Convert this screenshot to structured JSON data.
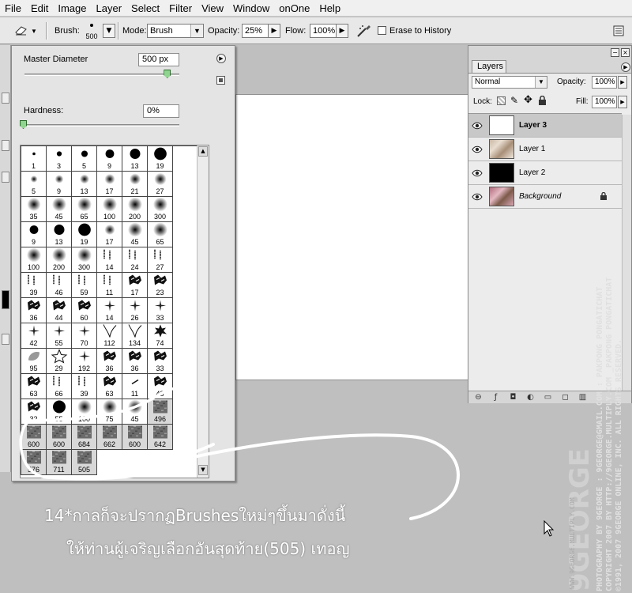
{
  "menu": [
    "File",
    "Edit",
    "Image",
    "Layer",
    "Select",
    "Filter",
    "View",
    "Window",
    "onOne",
    "Help"
  ],
  "options_bar": {
    "brush_label": "Brush:",
    "brush_size": "500",
    "mode_label": "Mode:",
    "mode_value": "Brush",
    "opacity_label": "Opacity:",
    "opacity_value": "25%",
    "flow_label": "Flow:",
    "flow_value": "100%",
    "erase_to_history_label": "Erase to History",
    "erase_to_history_checked": false
  },
  "brush_picker": {
    "master_diameter_label": "Master Diameter",
    "master_diameter_value": "500 px",
    "master_diameter_fraction": 0.92,
    "hardness_label": "Hardness:",
    "hardness_value": "0%",
    "hardness_fraction": 0.0,
    "brushes": [
      {
        "size": "1",
        "kind": "hard"
      },
      {
        "size": "3",
        "kind": "hard"
      },
      {
        "size": "5",
        "kind": "hard"
      },
      {
        "size": "9",
        "kind": "hard"
      },
      {
        "size": "13",
        "kind": "hard"
      },
      {
        "size": "19",
        "kind": "hard"
      },
      {
        "size": "5",
        "kind": "soft"
      },
      {
        "size": "9",
        "kind": "soft"
      },
      {
        "size": "13",
        "kind": "soft"
      },
      {
        "size": "17",
        "kind": "soft"
      },
      {
        "size": "21",
        "kind": "soft"
      },
      {
        "size": "27",
        "kind": "soft"
      },
      {
        "size": "35",
        "kind": "soft"
      },
      {
        "size": "45",
        "kind": "soft"
      },
      {
        "size": "65",
        "kind": "soft"
      },
      {
        "size": "100",
        "kind": "soft"
      },
      {
        "size": "200",
        "kind": "soft"
      },
      {
        "size": "300",
        "kind": "soft"
      },
      {
        "size": "9",
        "kind": "hard"
      },
      {
        "size": "13",
        "kind": "hard"
      },
      {
        "size": "19",
        "kind": "hard"
      },
      {
        "size": "17",
        "kind": "soft"
      },
      {
        "size": "45",
        "kind": "soft"
      },
      {
        "size": "65",
        "kind": "soft"
      },
      {
        "size": "100",
        "kind": "soft"
      },
      {
        "size": "200",
        "kind": "soft"
      },
      {
        "size": "300",
        "kind": "soft"
      },
      {
        "size": "14",
        "kind": "splatter"
      },
      {
        "size": "24",
        "kind": "splatter"
      },
      {
        "size": "27",
        "kind": "splatter"
      },
      {
        "size": "39",
        "kind": "splatter"
      },
      {
        "size": "46",
        "kind": "splatter"
      },
      {
        "size": "59",
        "kind": "splatter"
      },
      {
        "size": "11",
        "kind": "splatter"
      },
      {
        "size": "17",
        "kind": "chalk"
      },
      {
        "size": "23",
        "kind": "chalk"
      },
      {
        "size": "36",
        "kind": "chalk"
      },
      {
        "size": "44",
        "kind": "chalk"
      },
      {
        "size": "60",
        "kind": "chalk"
      },
      {
        "size": "14",
        "kind": "star"
      },
      {
        "size": "26",
        "kind": "star"
      },
      {
        "size": "33",
        "kind": "star"
      },
      {
        "size": "42",
        "kind": "star"
      },
      {
        "size": "55",
        "kind": "star"
      },
      {
        "size": "70",
        "kind": "star"
      },
      {
        "size": "112",
        "kind": "grass"
      },
      {
        "size": "134",
        "kind": "grass"
      },
      {
        "size": "74",
        "kind": "leaf"
      },
      {
        "size": "95",
        "kind": "leaf-soft"
      },
      {
        "size": "29",
        "kind": "outline-star"
      },
      {
        "size": "192",
        "kind": "star"
      },
      {
        "size": "36",
        "kind": "chalk"
      },
      {
        "size": "36",
        "kind": "chalk"
      },
      {
        "size": "33",
        "kind": "chalk"
      },
      {
        "size": "63",
        "kind": "chalk"
      },
      {
        "size": "66",
        "kind": "splatter"
      },
      {
        "size": "39",
        "kind": "splatter"
      },
      {
        "size": "63",
        "kind": "chalk"
      },
      {
        "size": "11",
        "kind": "stroke"
      },
      {
        "size": "48",
        "kind": "chalk"
      },
      {
        "size": "32",
        "kind": "chalk"
      },
      {
        "size": "55",
        "kind": "hard"
      },
      {
        "size": "100",
        "kind": "soft"
      },
      {
        "size": "75",
        "kind": "soft"
      },
      {
        "size": "45",
        "kind": "soft"
      },
      {
        "size": "496",
        "kind": "texture"
      },
      {
        "size": "600",
        "kind": "texture"
      },
      {
        "size": "600",
        "kind": "texture"
      },
      {
        "size": "684",
        "kind": "texture"
      },
      {
        "size": "662",
        "kind": "texture"
      },
      {
        "size": "600",
        "kind": "texture"
      },
      {
        "size": "642",
        "kind": "texture"
      },
      {
        "size": "576",
        "kind": "texture"
      },
      {
        "size": "711",
        "kind": "texture"
      },
      {
        "size": "505",
        "kind": "texture"
      }
    ]
  },
  "layers_panel": {
    "tab_label": "Layers",
    "blend_mode": "Normal",
    "opacity_label": "Opacity:",
    "opacity_value": "100%",
    "lock_label": "Lock:",
    "fill_label": "Fill:",
    "fill_value": "100%",
    "layers": [
      {
        "name": "Layer 3",
        "selected": true,
        "thumb": "white",
        "italic": false,
        "locked": false
      },
      {
        "name": "Layer 1",
        "selected": false,
        "thumb": "photo-light",
        "italic": false,
        "locked": false
      },
      {
        "name": "Layer 2",
        "selected": false,
        "thumb": "black",
        "italic": false,
        "locked": false
      },
      {
        "name": "Background",
        "selected": false,
        "thumb": "photo",
        "italic": true,
        "locked": true
      }
    ]
  },
  "annotation": {
    "line1": "14*กาลก็จะปรากฏBrushesใหม่ๆขึ้นมาดั่งนี้",
    "line2": "ให้ท่านผู้เจริญเลือกอันสุดท้าย(505) เทอญ"
  },
  "watermark": {
    "logo": "9GEORGE",
    "url_small": "WWW.9GEORGE.MULTIPLY.COM",
    "line1": "PHOTOGRAPHY BY 9GEORGE : 9GEORGE@GMAIL.COM : PAKPONG PONGATICHAT",
    "line2": "COPYRIGHT 2007 BY HTTP://9GEORGE.MULTIPLY.COM _PAKPONG PONGATICHAT",
    "line3": "©1991, 2007 9GEORGE ONLINE, INC. ALL RIGHTS RESERVED."
  },
  "colors": {
    "workspace": "#bfbfbf",
    "panel": "#e4e4e4",
    "annotation": "#ffffff"
  }
}
